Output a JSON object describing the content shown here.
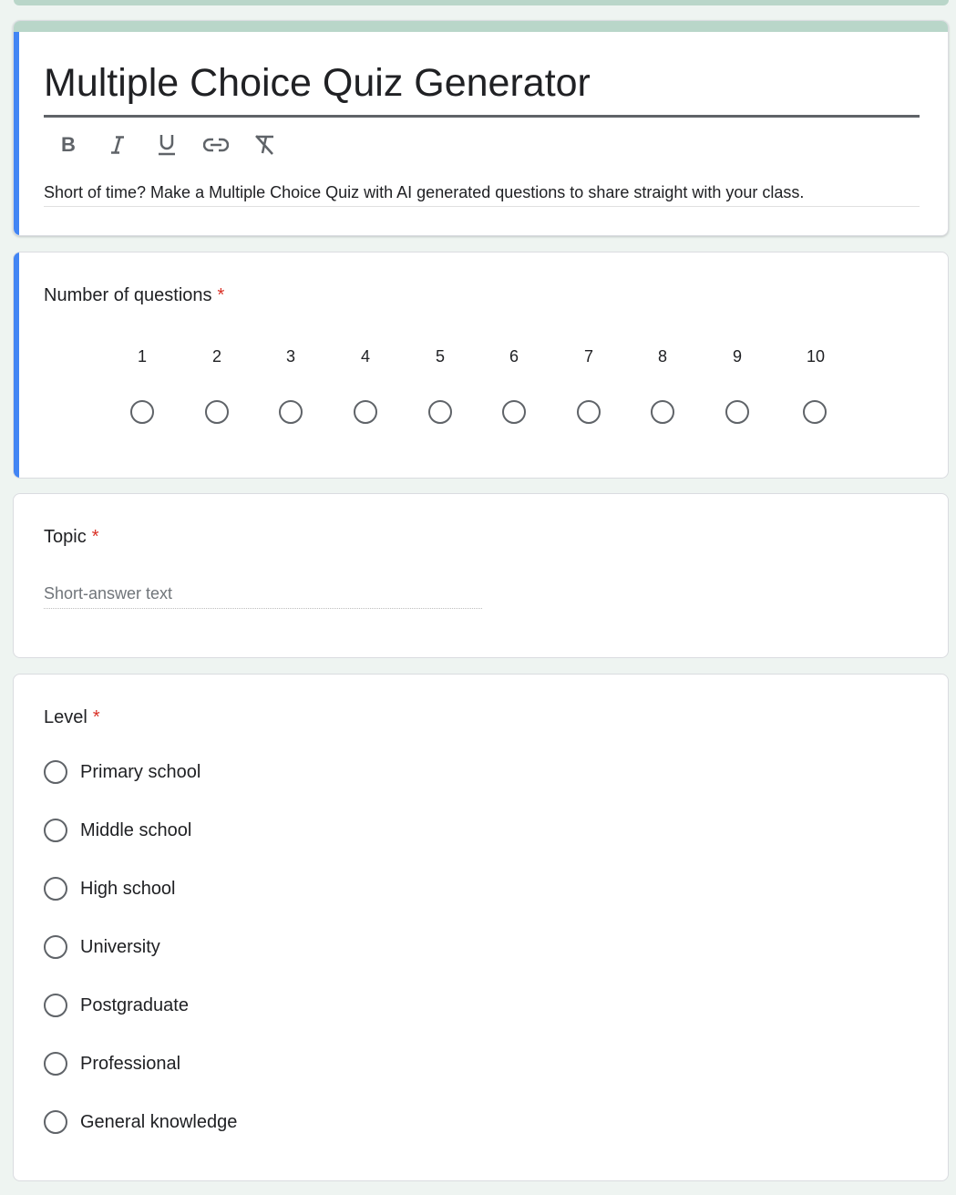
{
  "form": {
    "title": "Multiple Choice Quiz Generator",
    "description": "Short of time? Make a Multiple Choice Quiz with AI generated questions to share straight with your class.",
    "toolbar": {
      "bold": "B",
      "italic": "I",
      "underline": "U",
      "link_icon": "link-icon",
      "clear_format_icon": "clear-formatting-icon"
    }
  },
  "questions": {
    "number": {
      "title": "Number of questions",
      "required": "*",
      "scale": [
        "1",
        "2",
        "3",
        "4",
        "5",
        "6",
        "7",
        "8",
        "9",
        "10"
      ]
    },
    "topic": {
      "title": "Topic",
      "required": "*",
      "placeholder": "Short-answer text"
    },
    "level": {
      "title": "Level",
      "required": "*",
      "options": [
        "Primary school",
        "Middle school",
        "High school",
        "University",
        "Postgraduate",
        "Professional",
        "General knowledge"
      ]
    }
  },
  "colors": {
    "accent": "#4285f4",
    "theme": "#b9d6c9",
    "required": "#d93025",
    "background": "#eef4f1"
  }
}
